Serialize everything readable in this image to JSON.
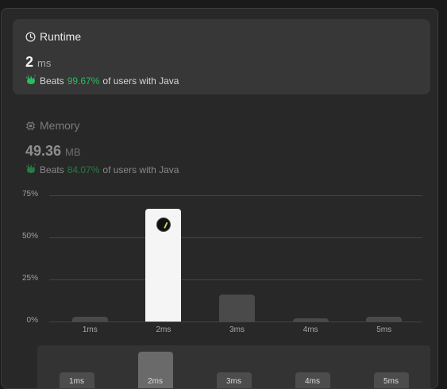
{
  "runtime": {
    "title": "Runtime",
    "icon": "clock-icon",
    "value": "2",
    "unit": "ms",
    "beats_label": "Beats",
    "beats_pct": "99.67%",
    "beats_suffix": "of users with Java"
  },
  "memory": {
    "title": "Memory",
    "icon": "chip-icon",
    "value": "49.36",
    "unit": "MB",
    "beats_label": "Beats",
    "beats_pct": "84.07%",
    "beats_suffix": "of users with Java"
  },
  "colors": {
    "accent_green": "#2cbb5d",
    "active_bar": "#f5f5f5",
    "inactive_bar": "#4a4a4a"
  },
  "chart_data": {
    "type": "bar",
    "categories": [
      "1ms",
      "2ms",
      "3ms",
      "4ms",
      "5ms"
    ],
    "values": [
      3,
      67,
      16,
      2,
      3
    ],
    "y_ticks": [
      "75%",
      "50%",
      "25%",
      "0%"
    ],
    "ylim": [
      0,
      75
    ],
    "highlight_index": 1,
    "grid": true
  },
  "navigator": {
    "labels": [
      "1ms",
      "2ms",
      "3ms",
      "4ms",
      "5ms"
    ],
    "active_index": 1
  }
}
